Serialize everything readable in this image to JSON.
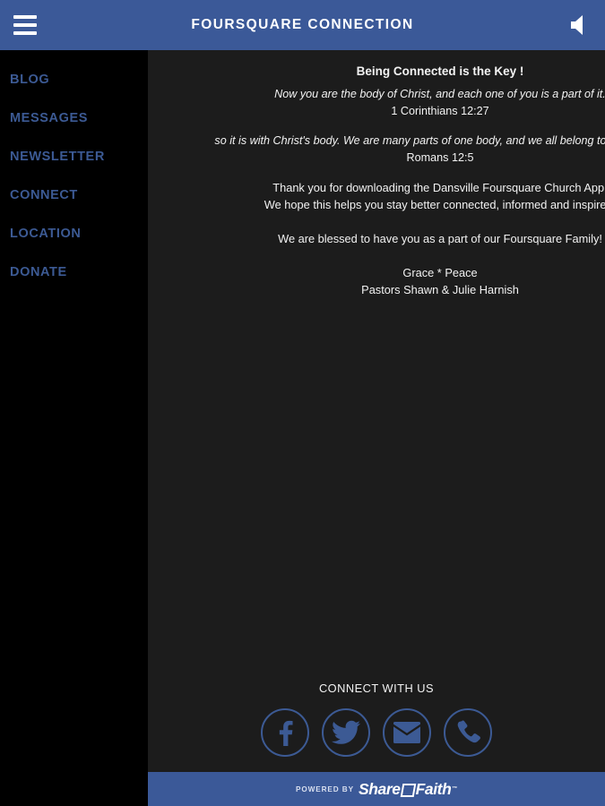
{
  "header": {
    "title": "FOURSQUARE CONNECTION",
    "menu_icon": "hamburger-menu-icon",
    "sound_icon": "speaker-mute-icon",
    "background_color": "#3b5998"
  },
  "sidebar": {
    "background_color": "#000000",
    "link_color": "#3c5a94",
    "items": [
      {
        "label": "BLOG"
      },
      {
        "label": "MESSAGES"
      },
      {
        "label": "NEWSLETTER"
      },
      {
        "label": "CONNECT"
      },
      {
        "label": "LOCATION"
      },
      {
        "label": "DONATE"
      }
    ]
  },
  "content": {
    "background_color": "#1c1c1c",
    "heading": "Being Connected is the Key !",
    "verse_one_text": "Now you are the body of Christ, and each one of you is a part of it.",
    "verse_one_ref": "1 Corinthians 12:27",
    "verse_two_text": "so it is with Christ's body. We are many parts of one body, and we all belong to each other.",
    "verse_two_ref": "Romans 12:5",
    "paragraph_line_one": "Thank you for downloading the Dansville Foursquare Church App!",
    "paragraph_line_two": "We hope this helps you stay better connected, informed and inspired!",
    "paragraph_line_three": "We are blessed to have you as a part of our Foursquare Family!",
    "signoff_line_one": "Grace * Peace",
    "signoff_line_two": "Pastors Shawn & Julie Harnish"
  },
  "connect": {
    "label": "CONNECT WITH US",
    "icon_color": "#3c5a94",
    "icons": [
      {
        "name": "facebook-icon"
      },
      {
        "name": "twitter-icon"
      },
      {
        "name": "email-icon"
      },
      {
        "name": "phone-icon"
      }
    ]
  },
  "footer": {
    "powered_by": "POWERED BY",
    "brand_part_one": "Share",
    "brand_part_two": "Faith",
    "trademark": "™",
    "background_color": "#3b5998"
  }
}
